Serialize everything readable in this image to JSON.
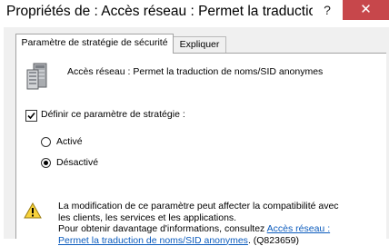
{
  "window": {
    "title": "Propriétés de : Accès réseau : Permet la traduction...",
    "help_glyph": "?",
    "close_glyph": "✕"
  },
  "tabs": [
    {
      "label": "Paramètre de stratégie de sécurité",
      "active": true
    },
    {
      "label": "Expliquer",
      "active": false
    }
  ],
  "policy": {
    "icon": "server-policy-icon",
    "name": "Accès réseau : Permet la traduction de noms/SID anonymes"
  },
  "define_checkbox": {
    "label": "Définir ce paramètre de stratégie :",
    "checked": true
  },
  "options": [
    {
      "label": "Activé",
      "selected": false
    },
    {
      "label": "Désactivé",
      "selected": true
    }
  ],
  "warning": {
    "icon": "warning-icon",
    "line1": "La modification de ce paramètre peut affecter la compatibilité avec",
    "line2": "les clients, les services et les applications.",
    "line3_prefix": "Pour obtenir davantage d'informations, consultez ",
    "link_part1": "Accès réseau :",
    "link_part2": "Permet la traduction de noms/SID anonymes",
    "suffix": ". (Q823659)"
  },
  "colors": {
    "close_button": "#c7474b",
    "link": "#0b5bbd",
    "dialog_bg": "#f0f0f0"
  }
}
